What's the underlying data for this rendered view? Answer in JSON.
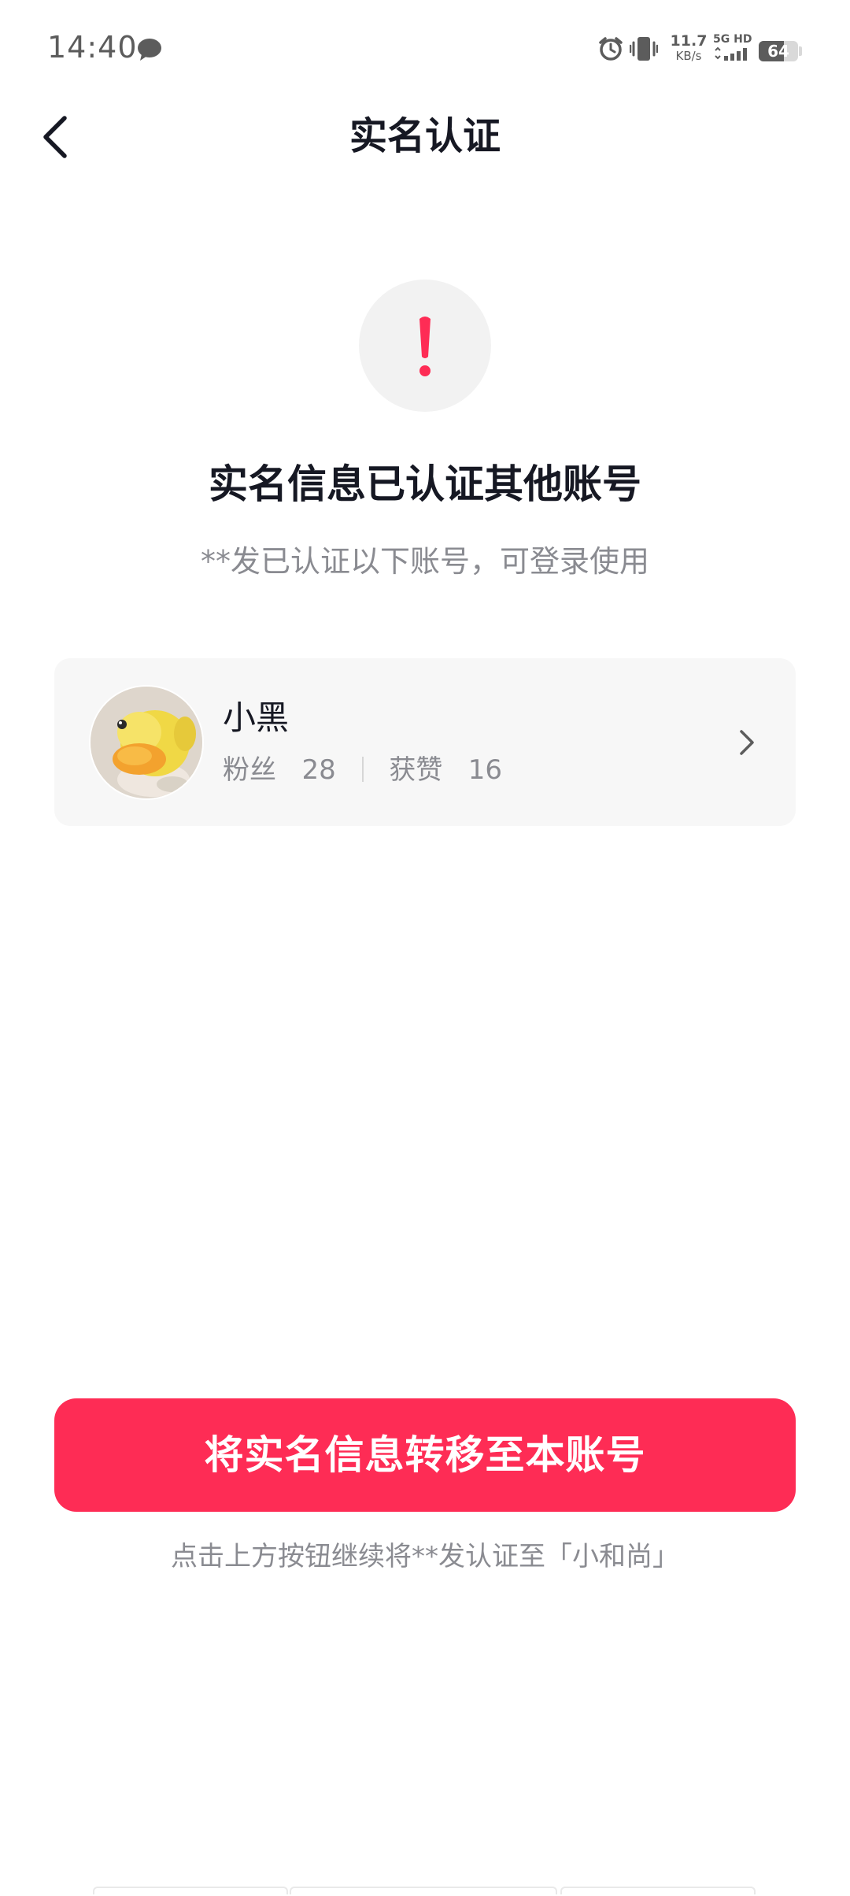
{
  "status_bar": {
    "time": "14:40",
    "net_speed_value": "11.7",
    "net_speed_unit": "KB/s",
    "network_label": "5G HD",
    "battery_level": 64,
    "battery_text": "64"
  },
  "header": {
    "title": "实名认证"
  },
  "notice": {
    "headline": "实名信息已认证其他账号",
    "subline": "**发已认证以下账号，可登录使用"
  },
  "account": {
    "name": "小黑",
    "fans_label": "粉丝",
    "fans_count": "28",
    "likes_label": "获赞",
    "likes_count": "16"
  },
  "actions": {
    "transfer_label": "将实名信息转移至本账号",
    "hint": "点击上方按钮继续将**发认证至「小和尚」"
  },
  "colors": {
    "accent": "#fe2c55",
    "text_primary": "#161823",
    "text_secondary": "#8a8b91"
  }
}
